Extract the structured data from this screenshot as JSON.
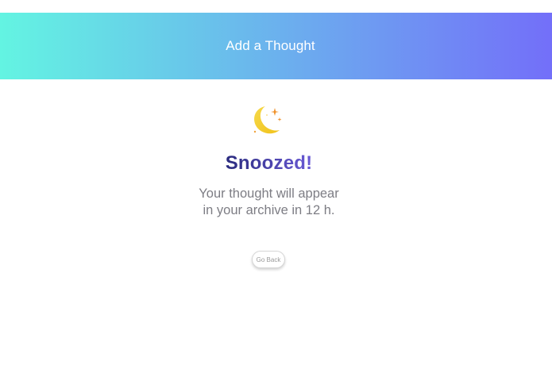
{
  "header": {
    "title": "Add a Thought",
    "gradient_start": "#63f4e2",
    "gradient_end": "#736ff9"
  },
  "status": {
    "icon": "crescent-moon-with-stars-icon",
    "headline": "Snoozed!",
    "headline_color_start": "#2a2b7e",
    "headline_color_end": "#6a5ad6",
    "message_line_1": "Your thought will appear",
    "message_line_2": "in your archive in 12 h."
  },
  "actions": {
    "go_back_label": "Go Back"
  }
}
